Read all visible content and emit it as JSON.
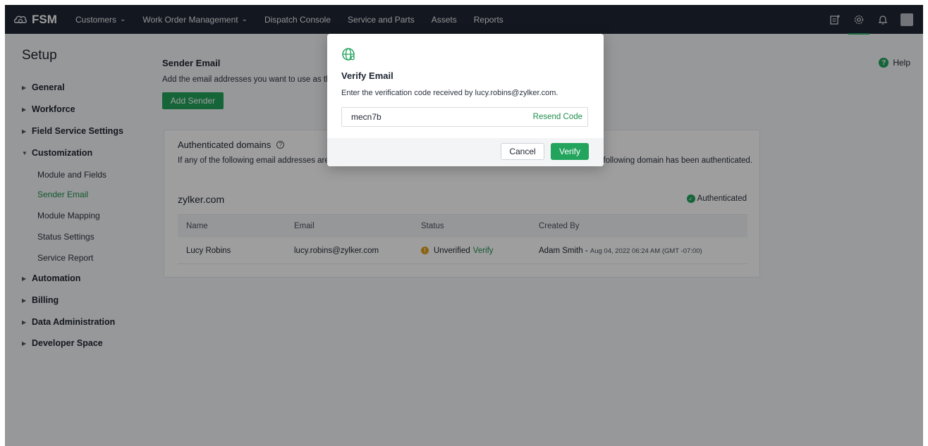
{
  "nav": {
    "brand": "FSM",
    "items": [
      {
        "label": "Customers",
        "dropdown": true
      },
      {
        "label": "Work Order Management",
        "dropdown": true
      },
      {
        "label": "Dispatch Console",
        "dropdown": false
      },
      {
        "label": "Service and Parts",
        "dropdown": false
      },
      {
        "label": "Assets",
        "dropdown": false
      },
      {
        "label": "Reports",
        "dropdown": false
      }
    ],
    "icons": [
      "new-note-icon",
      "gear-icon",
      "bell-icon",
      "avatar"
    ]
  },
  "sidebar": {
    "title": "Setup",
    "items": [
      {
        "label": "General",
        "expanded": false
      },
      {
        "label": "Workforce",
        "expanded": false
      },
      {
        "label": "Field Service Settings",
        "expanded": false
      },
      {
        "label": "Customization",
        "expanded": true
      },
      {
        "label": "Automation",
        "expanded": false
      },
      {
        "label": "Billing",
        "expanded": false
      },
      {
        "label": "Data Administration",
        "expanded": false
      },
      {
        "label": "Developer Space",
        "expanded": false
      }
    ],
    "subitems": [
      {
        "label": "Module and Fields",
        "active": false
      },
      {
        "label": "Sender Email",
        "active": true
      },
      {
        "label": "Module Mapping",
        "active": false
      },
      {
        "label": "Status Settings",
        "active": false
      },
      {
        "label": "Service Report",
        "active": false
      }
    ]
  },
  "main": {
    "title": "Sender Email",
    "description": "Add the email addresses you want to use as the sender address when emails are sent from FSM.",
    "add_sender_label": "Add Sender",
    "help_label": "Help",
    "card": {
      "title": "Authenticated domains",
      "description": "If any of the following email addresses are sent from FSM, the emails will be delivered with the sender address, as the following domain has been authenticated.",
      "domain": "zylker.com",
      "status": "Authenticated",
      "columns": [
        "Name",
        "Email",
        "Status",
        "Created By"
      ],
      "row": {
        "name": "Lucy Robins",
        "email": "lucy.robins@zylker.com",
        "status": "Unverified",
        "verify_link": "Verify",
        "created_by": "Adam Smith -",
        "created_date": "Aug 04, 2022 06:24 AM (GMT -07:00)"
      }
    }
  },
  "modal": {
    "title": "Verify Email",
    "description": "Enter the verification code received by lucy.robins@zylker.com.",
    "code_value": "mecn7b",
    "resend_label": "Resend Code",
    "cancel_label": "Cancel",
    "verify_label": "Verify"
  },
  "colors": {
    "nav_bg": "#1f2633",
    "accent": "#22a45d",
    "accent_text": "#1e8e4e",
    "warning": "#e0a21b"
  }
}
